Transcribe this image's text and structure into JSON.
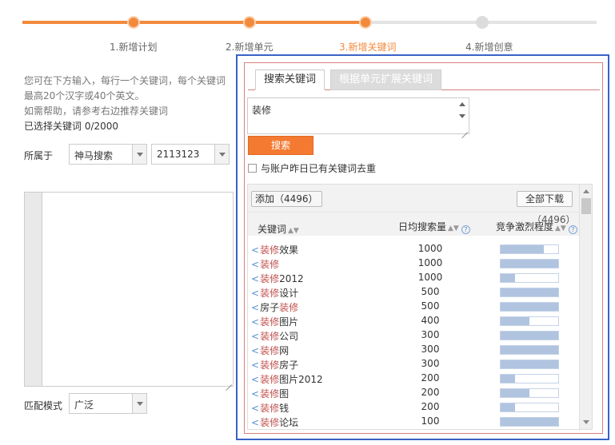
{
  "steps": [
    {
      "label": "1.新增计划",
      "state": "done"
    },
    {
      "label": "2.新增单元",
      "state": "done"
    },
    {
      "label": "3.新增关键词",
      "state": "active"
    },
    {
      "label": "4.新增创意",
      "state": "todo"
    }
  ],
  "left": {
    "help_line1": "您可在下方输入，每行一个关键词，每个关键词",
    "help_line2": "最高20个汉字或40个英文。",
    "help_line3": "如需帮助，请参考右边推荐关键词",
    "selected_count": "已选择关键词 0/2000",
    "owner_label": "所属于",
    "engine_select": "神马搜索",
    "unit_select": "2113123",
    "match_label": "匹配模式",
    "match_select": "广泛"
  },
  "right": {
    "tab_search": "搜索关键词",
    "tab_expand": "根据单元扩展关键词",
    "search_value": "装修",
    "search_button": "搜索",
    "dedupe_label": "与账户昨日已有关键词去重",
    "add_button": "添加（4496）",
    "download_button": "全部下载",
    "count_label": "（4496）",
    "col_keyword": "关键词",
    "col_volume": "日均搜索量",
    "col_competition": "竞争激烈程度",
    "rows": [
      {
        "prefix": "",
        "hl": "装修",
        "suffix": "效果",
        "volume": "1000",
        "competition": 0.75
      },
      {
        "prefix": "",
        "hl": "装修",
        "suffix": "",
        "volume": "1000",
        "competition": 1.0
      },
      {
        "prefix": "",
        "hl": "装修",
        "suffix": "2012",
        "volume": "1000",
        "competition": 0.25
      },
      {
        "prefix": "",
        "hl": "装修",
        "suffix": "设计",
        "volume": "500",
        "competition": 1.0
      },
      {
        "prefix": "房子",
        "hl": "装修",
        "suffix": "",
        "volume": "500",
        "competition": 1.0
      },
      {
        "prefix": "",
        "hl": "装修",
        "suffix": "图片",
        "volume": "400",
        "competition": 0.5
      },
      {
        "prefix": "",
        "hl": "装修",
        "suffix": "公司",
        "volume": "300",
        "competition": 1.0
      },
      {
        "prefix": "",
        "hl": "装修",
        "suffix": "网",
        "volume": "300",
        "competition": 1.0
      },
      {
        "prefix": "",
        "hl": "装修",
        "suffix": "房子",
        "volume": "300",
        "competition": 1.0
      },
      {
        "prefix": "",
        "hl": "装修",
        "suffix": "图片2012",
        "volume": "200",
        "competition": 0.25
      },
      {
        "prefix": "",
        "hl": "装修",
        "suffix": "图",
        "volume": "200",
        "competition": 0.5
      },
      {
        "prefix": "",
        "hl": "装修",
        "suffix": "钱",
        "volume": "200",
        "competition": 0.25
      },
      {
        "prefix": "",
        "hl": "装修",
        "suffix": "论坛",
        "volume": "100",
        "competition": 1.0
      }
    ]
  },
  "colors": {
    "accent": "#f28a3c",
    "highlight_border": "#3a62c6",
    "keyword_highlight": "#c0504d",
    "bar_fill": "#b0c4e0"
  }
}
